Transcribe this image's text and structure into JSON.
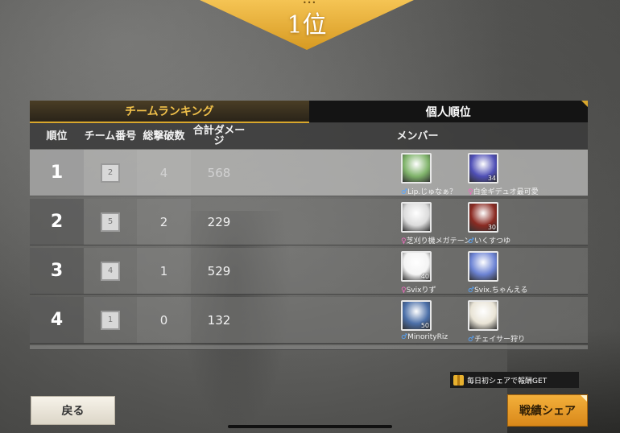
{
  "banner": {
    "title": "1位"
  },
  "tabs": [
    {
      "label": "チームランキング",
      "active": true
    },
    {
      "label": "個人順位",
      "active": false
    }
  ],
  "table": {
    "headers": {
      "rank": "順位",
      "team": "チーム番号",
      "kills": "総撃破数",
      "damage": "合計ダメージ",
      "members": "メンバー"
    },
    "rows": [
      {
        "rank": "1",
        "team": "2",
        "kills": "4",
        "damage": "568",
        "members": [
          {
            "gender": "♂",
            "name": "Lip.じゅなぁ？",
            "level": "",
            "avatar_color": "#7fb36a"
          },
          {
            "gender": "♀",
            "name": "白金ギデュオ最可愛",
            "level": "34",
            "avatar_color": "#4f4fb6"
          }
        ]
      },
      {
        "rank": "2",
        "team": "5",
        "kills": "2",
        "damage": "229",
        "members": [
          {
            "gender": "♀",
            "name": "芝刈り機メガテーン",
            "level": "",
            "avatar_color": "#dcdcdc"
          },
          {
            "gender": "♂",
            "name": "いくすつゆ",
            "level": "30",
            "avatar_color": "#8a2a22"
          }
        ]
      },
      {
        "rank": "3",
        "team": "4",
        "kills": "1",
        "damage": "529",
        "members": [
          {
            "gender": "♀",
            "name": "Svixりず",
            "level": "40",
            "avatar_color": "#f4f4f4"
          },
          {
            "gender": "♂",
            "name": "Svix.ちゃんえる",
            "level": "",
            "avatar_color": "#6c83d4"
          }
        ]
      },
      {
        "rank": "4",
        "team": "1",
        "kills": "0",
        "damage": "132",
        "members": [
          {
            "gender": "♂",
            "name": "MinorityRiz",
            "level": "50",
            "avatar_color": "#4b6fa8"
          },
          {
            "gender": "♂",
            "name": "チェイサー狩り",
            "level": "",
            "avatar_color": "#e9e4d6"
          }
        ]
      }
    ]
  },
  "footer": {
    "back_label": "戻る",
    "share_note": "毎日初シェアで報酬GET",
    "share_label": "戦績シェア"
  },
  "colors": {
    "accent_gold": "#d9a72c",
    "share_orange": "#e69a27"
  }
}
